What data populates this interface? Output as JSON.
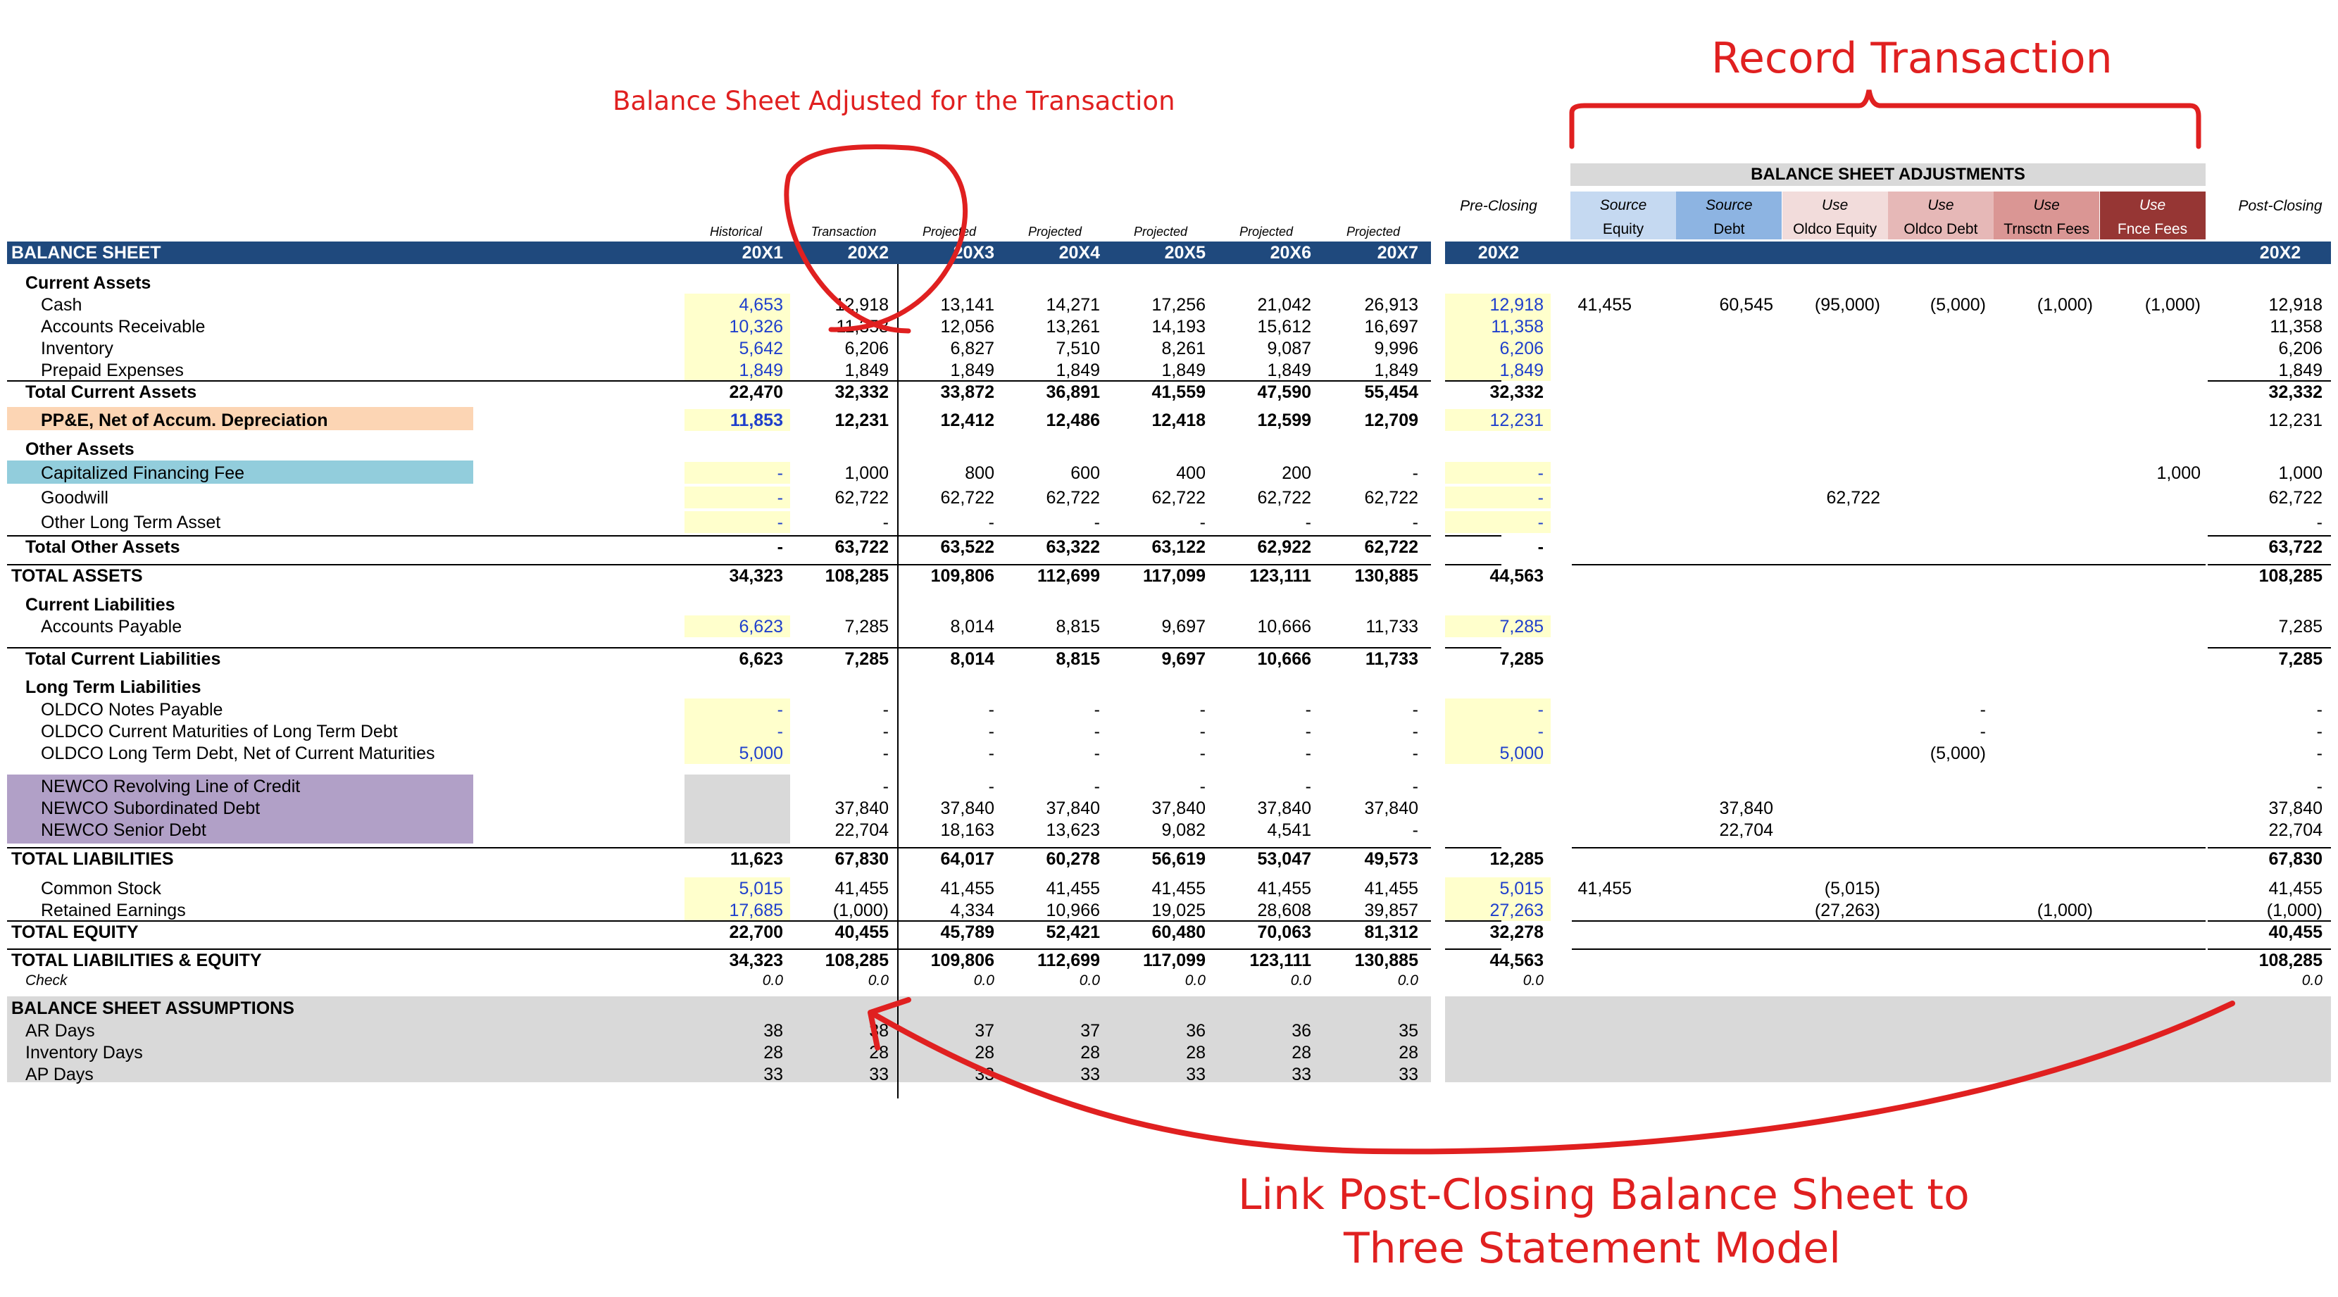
{
  "annotations": {
    "record_transaction": "Record Transaction",
    "balance_adjusted": "Balance Sheet Adjusted for the Transaction",
    "link_line1": "Link Post-Closing Balance Sheet to",
    "link_line2": "Three Statement Model"
  },
  "model": {
    "title": "BALANCE SHEET",
    "column_types": [
      "Historical",
      "Transaction",
      "Projected",
      "Projected",
      "Projected",
      "Projected",
      "Projected"
    ],
    "years": [
      "20X1",
      "20X2",
      "20X3",
      "20X4",
      "20X5",
      "20X6",
      "20X7"
    ],
    "rows": [
      {
        "label": "Current Assets",
        "kind": "section",
        "values": []
      },
      {
        "label": "Cash",
        "kind": "item",
        "values": [
          "4,653",
          "12,918",
          "13,141",
          "14,271",
          "17,256",
          "21,042",
          "26,913"
        ]
      },
      {
        "label": "Accounts Receivable",
        "kind": "item",
        "values": [
          "10,326",
          "11,358",
          "12,056",
          "13,261",
          "14,193",
          "15,612",
          "16,697"
        ]
      },
      {
        "label": "Inventory",
        "kind": "item",
        "values": [
          "5,642",
          "6,206",
          "6,827",
          "7,510",
          "8,261",
          "9,087",
          "9,996"
        ]
      },
      {
        "label": "Prepaid Expenses",
        "kind": "item",
        "values": [
          "1,849",
          "1,849",
          "1,849",
          "1,849",
          "1,849",
          "1,849",
          "1,849"
        ]
      },
      {
        "label": "Total Current Assets",
        "kind": "total",
        "values": [
          "22,470",
          "32,332",
          "33,872",
          "36,891",
          "41,559",
          "47,590",
          "55,454"
        ]
      },
      {
        "label": "PP&E, Net of Accum. Depreciation",
        "kind": "ppe",
        "values": [
          "11,853",
          "12,231",
          "12,412",
          "12,486",
          "12,418",
          "12,599",
          "12,709"
        ]
      },
      {
        "label": "Other Assets",
        "kind": "section",
        "values": []
      },
      {
        "label": "Capitalized Financing Fee",
        "kind": "cap",
        "values": [
          "-",
          "1,000",
          "800",
          "600",
          "400",
          "200",
          "-"
        ]
      },
      {
        "label": "Goodwill",
        "kind": "item",
        "values": [
          "-",
          "62,722",
          "62,722",
          "62,722",
          "62,722",
          "62,722",
          "62,722"
        ]
      },
      {
        "label": "Other Long Term Asset",
        "kind": "item",
        "values": [
          "-",
          "-",
          "-",
          "-",
          "-",
          "-",
          "-"
        ]
      },
      {
        "label": "Total Other Assets",
        "kind": "total",
        "values": [
          "-",
          "63,722",
          "63,522",
          "63,322",
          "63,122",
          "62,922",
          "62,722"
        ]
      },
      {
        "label": "TOTAL ASSETS",
        "kind": "grand",
        "values": [
          "34,323",
          "108,285",
          "109,806",
          "112,699",
          "117,099",
          "123,111",
          "130,885"
        ]
      },
      {
        "label": "Current Liabilities",
        "kind": "section",
        "values": []
      },
      {
        "label": "Accounts Payable",
        "kind": "item",
        "values": [
          "6,623",
          "7,285",
          "8,014",
          "8,815",
          "9,697",
          "10,666",
          "11,733"
        ]
      },
      {
        "label": "Total Current Liabilities",
        "kind": "total",
        "values": [
          "6,623",
          "7,285",
          "8,014",
          "8,815",
          "9,697",
          "10,666",
          "11,733"
        ]
      },
      {
        "label": "Long Term Liabilities",
        "kind": "section",
        "values": []
      },
      {
        "label": "OLDCO Notes Payable",
        "kind": "item",
        "values": [
          "-",
          "-",
          "-",
          "-",
          "-",
          "-",
          "-"
        ]
      },
      {
        "label": "OLDCO Current Maturities of Long Term Debt",
        "kind": "item",
        "values": [
          "-",
          "-",
          "-",
          "-",
          "-",
          "-",
          "-"
        ]
      },
      {
        "label": "OLDCO Long Term Debt, Net of Current Maturities",
        "kind": "item",
        "values": [
          "5,000",
          "-",
          "-",
          "-",
          "-",
          "-",
          "-"
        ]
      },
      {
        "label": "NEWCO Revolving Line of Credit",
        "kind": "newco",
        "values": [
          "",
          "-",
          "-",
          "-",
          "-",
          "-",
          "-"
        ]
      },
      {
        "label": "NEWCO Subordinated Debt",
        "kind": "newco",
        "values": [
          "",
          "37,840",
          "37,840",
          "37,840",
          "37,840",
          "37,840",
          "37,840"
        ]
      },
      {
        "label": "NEWCO Senior Debt",
        "kind": "newco",
        "values": [
          "",
          "22,704",
          "18,163",
          "13,623",
          "9,082",
          "4,541",
          "-"
        ]
      },
      {
        "label": "TOTAL LIABILITIES",
        "kind": "grand",
        "values": [
          "11,623",
          "67,830",
          "64,017",
          "60,278",
          "56,619",
          "53,047",
          "49,573"
        ]
      },
      {
        "label": "Common Stock",
        "kind": "item",
        "values": [
          "5,015",
          "41,455",
          "41,455",
          "41,455",
          "41,455",
          "41,455",
          "41,455"
        ]
      },
      {
        "label": "Retained Earnings",
        "kind": "item",
        "values": [
          "17,685",
          "(1,000)",
          "4,334",
          "10,966",
          "19,025",
          "28,608",
          "39,857"
        ]
      },
      {
        "label": "TOTAL EQUITY",
        "kind": "grand",
        "values": [
          "22,700",
          "40,455",
          "45,789",
          "52,421",
          "60,480",
          "70,063",
          "81,312"
        ]
      },
      {
        "label": "TOTAL LIABILITIES & EQUITY",
        "kind": "grand",
        "values": [
          "34,323",
          "108,285",
          "109,806",
          "112,699",
          "117,099",
          "123,111",
          "130,885"
        ]
      },
      {
        "label": "Check",
        "kind": "check",
        "values": [
          "0.0",
          "0.0",
          "0.0",
          "0.0",
          "0.0",
          "0.0",
          "0.0"
        ]
      }
    ],
    "assumptions": {
      "title": "BALANCE SHEET ASSUMPTIONS",
      "rows": [
        {
          "label": "AR Days",
          "values": [
            "38",
            "38",
            "37",
            "37",
            "36",
            "36",
            "35"
          ]
        },
        {
          "label": "Inventory Days",
          "values": [
            "28",
            "28",
            "28",
            "28",
            "28",
            "28",
            "28"
          ]
        },
        {
          "label": "AP Days",
          "values": [
            "33",
            "33",
            "33",
            "33",
            "33",
            "33",
            "33"
          ]
        }
      ]
    }
  },
  "adjustments": {
    "title": "BALANCE SHEET ADJUSTMENTS",
    "pre_closing_label": "Pre-Closing",
    "post_closing_label": "Post-Closing",
    "year": "20X2",
    "columns": [
      {
        "top": "Source",
        "bottom": "Equity",
        "color": "#c5d9f1"
      },
      {
        "top": "Source",
        "bottom": "Debt",
        "color": "#8db4e2"
      },
      {
        "top": "Use",
        "bottom": "Oldco Equity",
        "color": "#f2dcdb"
      },
      {
        "top": "Use",
        "bottom": "Oldco Debt",
        "color": "#e6b8b7"
      },
      {
        "top": "Use",
        "bottom": "Trnsctn Fees",
        "color": "#da9694"
      },
      {
        "top": "Use",
        "bottom": "Fnce Fees",
        "color": "#963634"
      }
    ],
    "pre": [
      "",
      "12,918",
      "11,358",
      "6,206",
      "1,849",
      "32,332",
      "12,231",
      "",
      "-",
      "-",
      "-",
      "-",
      "44,563",
      "",
      "7,285",
      "7,285",
      "",
      "-",
      "-",
      "5,000",
      "",
      "",
      "",
      "12,285",
      "5,015",
      "27,263",
      "32,278",
      "44,563",
      "0.0"
    ],
    "adj": [
      [],
      [
        "41,455",
        "60,545",
        "(95,000)",
        "(5,000)",
        "(1,000)",
        "(1,000)"
      ],
      [],
      [],
      [],
      [],
      [],
      [],
      [
        "",
        "",
        "",
        "",
        "",
        "1,000"
      ],
      [
        "",
        "",
        "62,722",
        "",
        "",
        ""
      ],
      [],
      [],
      [],
      [],
      [],
      [],
      [],
      [
        "",
        "",
        "",
        "-",
        "",
        ""
      ],
      [
        "",
        "",
        "",
        "-",
        "",
        ""
      ],
      [
        "",
        "",
        "",
        "(5,000)",
        "",
        ""
      ],
      [],
      [
        "",
        "37,840",
        "",
        "",
        "",
        ""
      ],
      [
        "",
        "22,704",
        "",
        "",
        "",
        ""
      ],
      [],
      [
        "41,455",
        "",
        "(5,015)",
        "",
        "",
        ""
      ],
      [
        "",
        "",
        "(27,263)",
        "",
        "(1,000)",
        ""
      ],
      [],
      [],
      []
    ],
    "post": [
      "",
      "12,918",
      "11,358",
      "6,206",
      "1,849",
      "32,332",
      "12,231",
      "",
      "1,000",
      "62,722",
      "-",
      "63,722",
      "108,285",
      "",
      "7,285",
      "7,285",
      "",
      "-",
      "-",
      "-",
      "-",
      "37,840",
      "22,704",
      "67,830",
      "41,455",
      "(1,000)",
      "40,455",
      "108,285",
      "0.0"
    ]
  },
  "colors": {
    "header": "#1f497d",
    "input_blue": "#1f3fcc",
    "highlight": "#ffffcc",
    "ppe": "#fcd5b4",
    "cap_fee": "#92cddc",
    "newco": "#b1a0c7",
    "annotation": "#e02020"
  }
}
